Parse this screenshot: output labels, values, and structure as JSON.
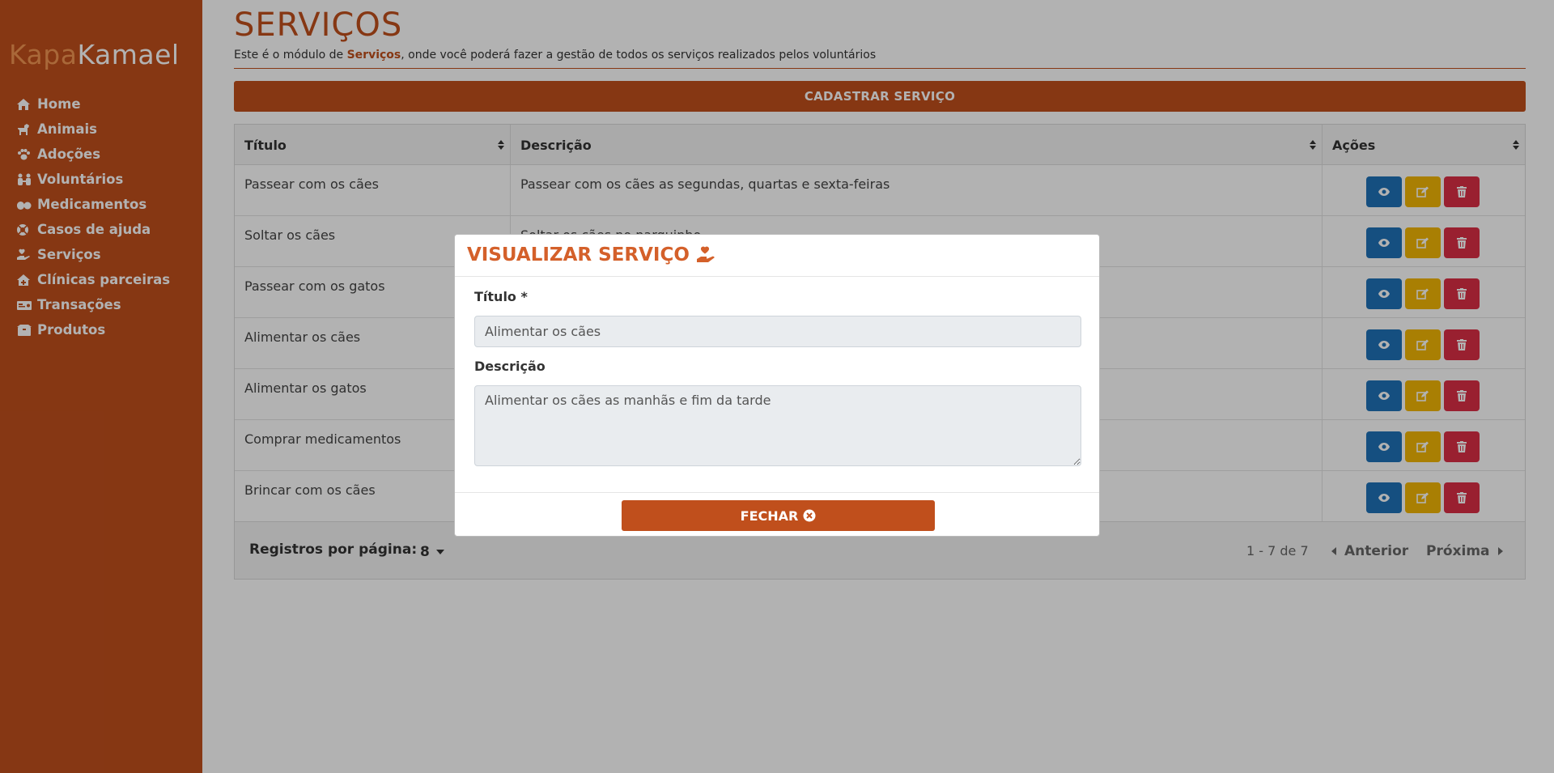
{
  "brand": {
    "part1": "Kapa",
    "part2": "Kamael"
  },
  "colors": {
    "sidebar": "#c04f1c",
    "accent": "#c04f1c",
    "view": "#1f72b8",
    "edit": "#f2b705",
    "delete": "#dc2f45"
  },
  "sidebar": {
    "items": [
      {
        "label": "Home",
        "icon": "home-icon"
      },
      {
        "label": "Animais",
        "icon": "dog-icon"
      },
      {
        "label": "Adoções",
        "icon": "paw-icon"
      },
      {
        "label": "Voluntários",
        "icon": "people-icon"
      },
      {
        "label": "Medicamentos",
        "icon": "pills-icon"
      },
      {
        "label": "Casos de ajuda",
        "icon": "lifebuoy-icon"
      },
      {
        "label": "Serviços",
        "icon": "hand-heart-icon"
      },
      {
        "label": "Clínicas parceiras",
        "icon": "clinic-icon"
      },
      {
        "label": "Transações",
        "icon": "money-icon"
      },
      {
        "label": "Produtos",
        "icon": "box-icon"
      }
    ]
  },
  "page": {
    "title": "SERVIÇOS",
    "subtitle_pre": "Este é o módulo de ",
    "subtitle_bold": "Serviços",
    "subtitle_post": ", onde você poderá fazer a gestão de todos os serviços realizados pelos voluntários",
    "register_button": "CADASTRAR SERVIÇO"
  },
  "table": {
    "headers": [
      "Título",
      "Descrição",
      "Ações"
    ],
    "rows": [
      {
        "title": "Passear com os cães",
        "description": "Passear com os cães as segundas, quartas e sexta-feiras"
      },
      {
        "title": "Soltar os cães",
        "description": "Soltar os cães no parquinho"
      },
      {
        "title": "Passear com os gatos",
        "description": ""
      },
      {
        "title": "Alimentar os cães",
        "description": ""
      },
      {
        "title": "Alimentar os gatos",
        "description": ""
      },
      {
        "title": "Comprar medicamentos",
        "description": ""
      },
      {
        "title": "Brincar com os cães",
        "description": ""
      }
    ],
    "footer": {
      "per_page_label": "Registros por página:",
      "per_page_value": "8",
      "range": "1 - 7 de 7",
      "prev": "Anterior",
      "next": "Próxima"
    }
  },
  "modal": {
    "title": "VISUALIZAR SERVIÇO",
    "title_label": "Título *",
    "title_value": "Alimentar os cães",
    "desc_label": "Descrição",
    "desc_value": "Alimentar os cães as manhãs e fim da tarde",
    "close_button": "FECHAR"
  }
}
